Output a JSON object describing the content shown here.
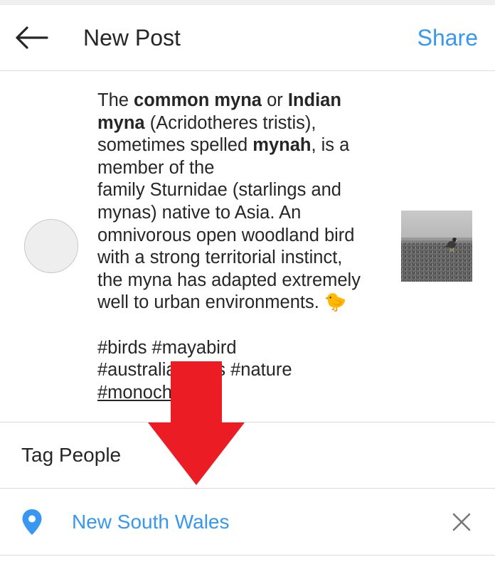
{
  "colors": {
    "accent": "#3897f0",
    "text": "#262626",
    "divider": "#dbdbdb",
    "arrow": "#ec1c24"
  },
  "header": {
    "back_icon": "back-arrow-icon",
    "title": "New Post",
    "share_label": "Share"
  },
  "caption": {
    "l1a": "The ",
    "l1b": "common myna",
    "l1c": " or ",
    "l1d": "Indian",
    "l2a": "myna",
    "l2b": " (Acridotheres tristis),",
    "l3a": "sometimes spelled ",
    "l3b": "mynah",
    "l3c": ", is a",
    "l4": "member of the",
    "l5": "family Sturnidae (starlings and",
    "l6": "mynas) native to Asia. An",
    "l7": "omnivorous open woodland bird",
    "l8": "with a strong territorial instinct,",
    "l9": "the myna has adapted extremely",
    "l10": "well to urban environments. ",
    "emoji": "🐤",
    "tags1": "#birds #mayabird",
    "tags2": "#australianbirds #nature",
    "tags3": "#monochrome"
  },
  "tag_people": {
    "label": "Tag People"
  },
  "location": {
    "icon": "location-pin-icon",
    "label": "New South Wales",
    "clear_icon": "close-icon"
  }
}
